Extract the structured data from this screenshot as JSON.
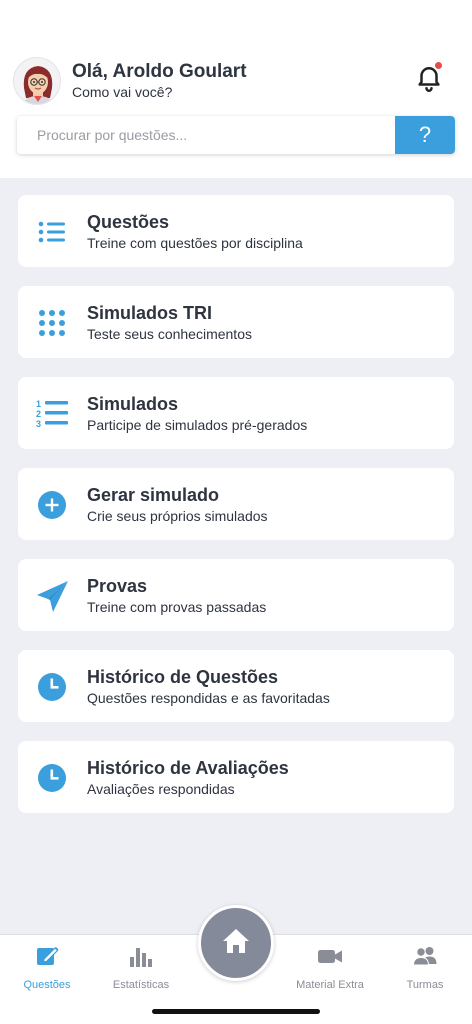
{
  "header": {
    "greeting": "Olá, Aroldo Goulart",
    "subgreeting": "Como vai você?"
  },
  "search": {
    "placeholder": "Procurar por questões...",
    "help_label": "?"
  },
  "menu": [
    {
      "title": "Questões",
      "subtitle": "Treine com questões por disciplina",
      "icon": "list-icon"
    },
    {
      "title": "Simulados TRI",
      "subtitle": "Teste seus conhecimentos",
      "icon": "grid-dots-icon"
    },
    {
      "title": "Simulados",
      "subtitle": "Participe de simulados pré-gerados",
      "icon": "numbered-list-icon"
    },
    {
      "title": "Gerar simulado",
      "subtitle": "Crie seus próprios simulados",
      "icon": "plus-circle-icon"
    },
    {
      "title": "Provas",
      "subtitle": "Treine com provas passadas",
      "icon": "paper-plane-icon"
    },
    {
      "title": "Histórico de Questões",
      "subtitle": "Questões respondidas e as favoritadas",
      "icon": "clock-icon"
    },
    {
      "title": "Histórico de Avaliações",
      "subtitle": "Avaliações respondidas",
      "icon": "clock-icon"
    }
  ],
  "tabs": [
    {
      "label": "Questões",
      "icon": "edit-icon",
      "active": true
    },
    {
      "label": "Estatísticas",
      "icon": "bar-chart-icon",
      "active": false
    },
    {
      "label": "Material Extra",
      "icon": "video-camera-icon",
      "active": false
    },
    {
      "label": "Turmas",
      "icon": "people-icon",
      "active": false
    }
  ],
  "colors": {
    "accent": "#3a9fdc",
    "background": "#eeeff4",
    "text": "#2e3440",
    "notification_dot": "#e54b4b",
    "home_button": "#848a99"
  }
}
